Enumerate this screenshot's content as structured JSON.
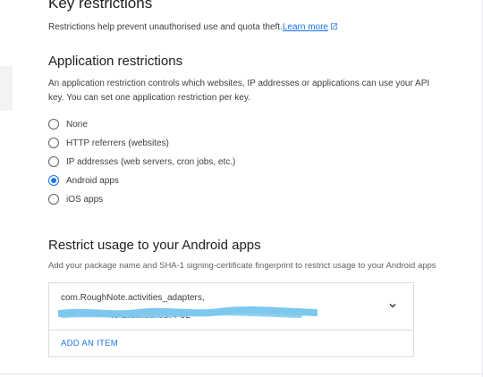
{
  "key_restrictions": {
    "title": "Key restrictions",
    "description": "Restrictions help prevent unauthorised use and quota theft.",
    "learn_more": "Learn more",
    "link_icon": "open-in-new-icon"
  },
  "application_restrictions": {
    "title": "Application restrictions",
    "description": "An application restriction controls which websites, IP addresses or applications can use your API key. You can set one application restriction per key.",
    "options": [
      {
        "label": "None",
        "checked": false
      },
      {
        "label": "HTTP referrers (websites)",
        "checked": false
      },
      {
        "label": "IP addresses (web servers, cron jobs, etc.)",
        "checked": false
      },
      {
        "label": "Android apps",
        "checked": true
      },
      {
        "label": "iOS apps",
        "checked": false
      }
    ]
  },
  "android": {
    "title": "Restrict usage to your Android apps",
    "description": "Add your package name and SHA-1 signing-certificate fingerprint to restrict usage to your Android apps",
    "item": {
      "package": "com.RoughNote.activities_adapters,",
      "fingerprint_visible": ":9 2:98:58:65:4 02",
      "expand_icon": "chevron-down-icon"
    },
    "add_item": "ADD AN ITEM"
  },
  "colors": {
    "accent": "#1a73e8",
    "redaction": "#7ec8ef"
  }
}
